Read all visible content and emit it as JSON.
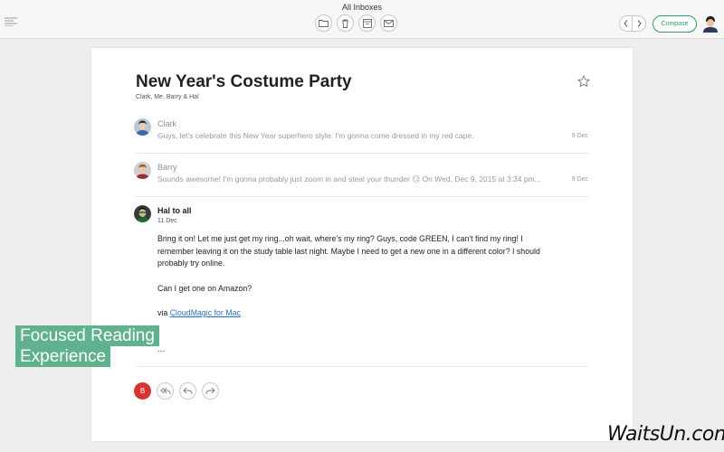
{
  "window": {
    "title": "All Inboxes"
  },
  "toolbar": {
    "icons": [
      "folder-icon",
      "trash-icon",
      "archive-icon",
      "envelope-icon"
    ],
    "compose_label": "Compose"
  },
  "email": {
    "subject": "New Year's Costume Party",
    "participants": "Clark, Me, Barry & Hal",
    "messages": [
      {
        "from": "Clark",
        "preview": "Guys, let's celebrate this New Year superhero style. I'm gonna come dressed in my red cape.",
        "date": "9 Dec"
      },
      {
        "from": "Barry",
        "preview": "Sounds awesome! I'm gonna probably just zoom in and steal your thunder 😏 On Wed, Dec 9, 2015 at 3:34 pm...",
        "date": "9 Dec"
      },
      {
        "from": "Hal to all",
        "date": "11 Dec",
        "body": [
          "Bring it on! Let me just get my ring...oh wait, where's my ring? Guys, code GREEN, I can't find my ring! I remember leaving it on the study table last night. Maybe I need to get a new one in a different color? I should probably try online.",
          "Can I get one on Amazon?"
        ],
        "via_prefix": "via ",
        "via_link": "CloudMagic for Mac",
        "ellipsis": "..."
      }
    ]
  },
  "reply": {
    "avatar_letter": "B"
  },
  "overlay": {
    "line1": "Focused Reading",
    "line2": "Experience"
  },
  "watermark": "WaitsUn.com",
  "colors": {
    "accent": "#2e9c5f",
    "badge": "#d5352e",
    "overlay": "#5fb28d",
    "link": "#2a71c2"
  }
}
